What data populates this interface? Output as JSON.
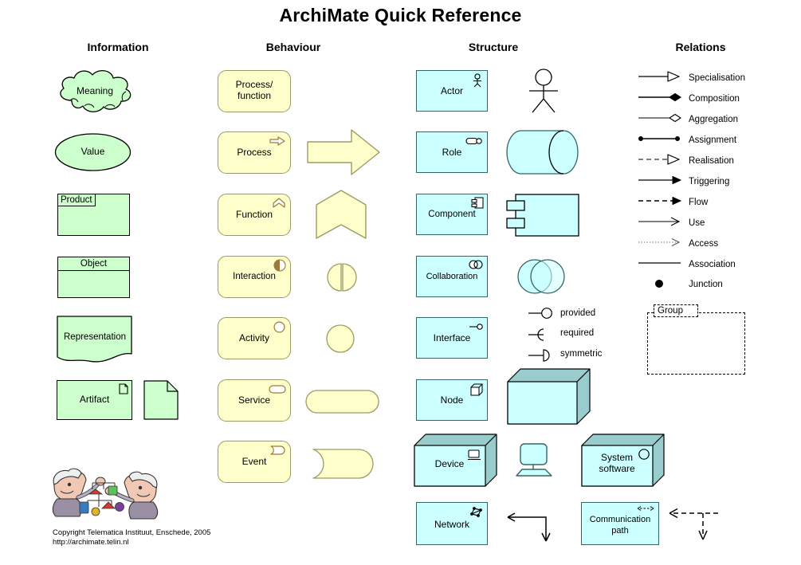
{
  "title": "ArchiMate Quick Reference",
  "columns": {
    "information": {
      "header": "Information"
    },
    "behaviour": {
      "header": "Behaviour"
    },
    "structure": {
      "header": "Structure"
    },
    "relations": {
      "header": "Relations"
    }
  },
  "information": {
    "items": [
      {
        "label": "Meaning",
        "shape": "cloud"
      },
      {
        "label": "Value",
        "shape": "ellipse"
      },
      {
        "label": "Product",
        "shape": "product-box"
      },
      {
        "label": "Object",
        "shape": "object-box"
      },
      {
        "label": "Representation",
        "shape": "wavy-box"
      },
      {
        "label": "Artifact",
        "shape": "artifact-box",
        "alt_shape": "folded-corner-page"
      }
    ]
  },
  "behaviour": {
    "items": [
      {
        "label": "Process/\nfunction",
        "label_line1": "Process/",
        "label_line2": "function",
        "icon": "none",
        "alt_shape": "none"
      },
      {
        "label": "Process",
        "icon": "arrow-icon",
        "alt_shape": "block-arrow"
      },
      {
        "label": "Function",
        "icon": "chevron-up-icon",
        "alt_shape": "chevron-block"
      },
      {
        "label": "Interaction",
        "icon": "split-circle-icon",
        "alt_shape": "split-circle"
      },
      {
        "label": "Activity",
        "icon": "circle-icon",
        "alt_shape": "circle"
      },
      {
        "label": "Service",
        "icon": "pill-icon",
        "alt_shape": "pill"
      },
      {
        "label": "Event",
        "icon": "event-icon",
        "alt_shape": "event-shape"
      }
    ]
  },
  "structure": {
    "items": [
      {
        "label": "Actor",
        "icon": "stick-figure-icon",
        "alt_shape": "stick-figure"
      },
      {
        "label": "Role",
        "icon": "lollipop-icon",
        "alt_shape": "cylinder"
      },
      {
        "label": "Component",
        "icon": "component-icon",
        "alt_shape": "uml-component"
      },
      {
        "label": "Collaboration",
        "icon": "two-circles-icon",
        "alt_shape": "two-circles"
      },
      {
        "label": "Interface",
        "icon": "interface-icon",
        "alt_shape": "interface-legend"
      },
      {
        "label": "Node",
        "icon": "cube-icon",
        "alt_shape": "3d-box"
      },
      {
        "label": "Device",
        "icon": "monitor-icon",
        "alt_shape": "monitor"
      },
      {
        "label": "System\nsoftware",
        "label_line1": "System",
        "label_line2": "software",
        "icon": "circle-icon",
        "alt_shape": "none"
      },
      {
        "label": "Network",
        "icon": "network-icon",
        "alt_shape": "bent-arrow"
      },
      {
        "label": "Communication\npath",
        "label_line1": "Communication",
        "label_line2": "path",
        "icon": "bidirectional-dashed-icon",
        "alt_shape": "dashed-arrow"
      }
    ],
    "interface_legend": [
      {
        "label": "provided"
      },
      {
        "label": "required"
      },
      {
        "label": "symmetric"
      }
    ]
  },
  "relations": {
    "items": [
      {
        "label": "Specialisation",
        "line": "solid",
        "head": "hollow-triangle"
      },
      {
        "label": "Composition",
        "line": "solid",
        "head": "filled-diamond"
      },
      {
        "label": "Aggregation",
        "line": "solid",
        "head": "hollow-diamond"
      },
      {
        "label": "Assignment",
        "line": "solid",
        "head": "ball-ball"
      },
      {
        "label": "Realisation",
        "line": "dashed",
        "head": "hollow-triangle"
      },
      {
        "label": "Triggering",
        "line": "solid",
        "head": "filled-arrow"
      },
      {
        "label": "Flow",
        "line": "dashed",
        "head": "filled-arrow"
      },
      {
        "label": "Use",
        "line": "solid",
        "head": "open-arrow"
      },
      {
        "label": "Access",
        "line": "dotted",
        "head": "open-arrow"
      },
      {
        "label": "Association",
        "line": "solid",
        "head": "none"
      },
      {
        "label": "Junction",
        "line": "none",
        "head": "filled-dot"
      }
    ],
    "group": {
      "label": "Group"
    }
  },
  "footer": {
    "copyright": "Copyright Telematica Instituut, Enschede, 2005",
    "url": "http://archimate.telin.nl",
    "logo": "telematica-cartoon-logo"
  },
  "colors": {
    "information_fill": "#ccffcc",
    "information_stroke": "#000000",
    "behaviour_fill": "#ffffcc",
    "behaviour_stroke": "#9b9b63",
    "structure_fill": "#ccffff",
    "structure_stroke": "#336666",
    "relation_stroke": "#000000"
  }
}
